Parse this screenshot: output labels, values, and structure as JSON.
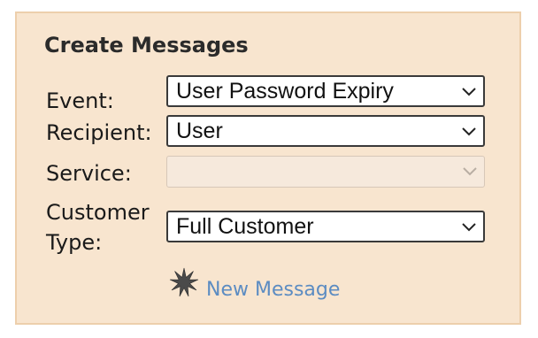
{
  "panel": {
    "title": "Create Messages",
    "fields": {
      "event": {
        "label": "Event:",
        "value": "User Password Expiry"
      },
      "recipient": {
        "label": "Recipient:",
        "value": "User"
      },
      "service": {
        "label": "Service:",
        "value": "",
        "disabled": true
      },
      "customer_type": {
        "label_line1": "Customer",
        "label_line2": "Type:",
        "value": "Full Customer"
      }
    },
    "new_message": {
      "label": "New Message",
      "icon": "starburst-icon",
      "link_color": "#5c8cc2"
    }
  },
  "colors": {
    "panel_background": "#f8e5cf",
    "panel_border": "#edcfac"
  }
}
